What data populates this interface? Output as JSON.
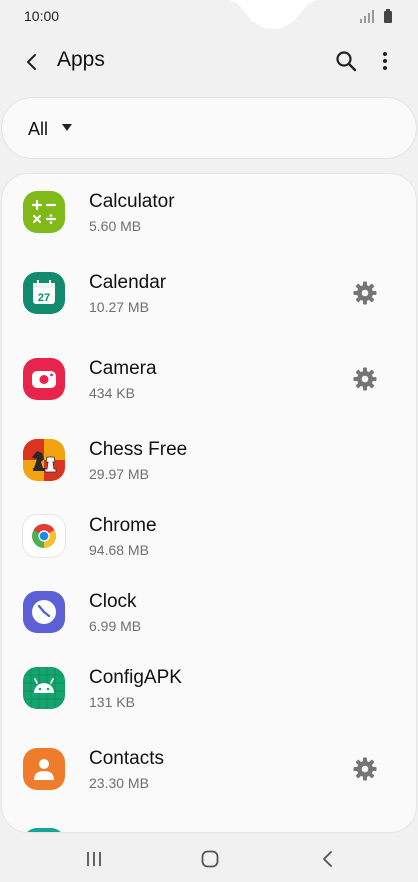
{
  "status": {
    "time": "10:00",
    "icons": [
      "signal-icon",
      "battery-icon"
    ]
  },
  "appbar": {
    "title": "Apps",
    "icons": [
      "back-icon",
      "search-icon",
      "more-vert-icon"
    ]
  },
  "filter": {
    "label": "All"
  },
  "apps": [
    {
      "name": "Calculator",
      "size": "5.60 MB",
      "icon": "calculator-icon",
      "settings": false
    },
    {
      "name": "Calendar",
      "size": "10.27 MB",
      "icon": "calendar-icon",
      "settings": true
    },
    {
      "name": "Camera",
      "size": "434 KB",
      "icon": "camera-icon",
      "settings": true
    },
    {
      "name": "Chess Free",
      "size": "29.97 MB",
      "icon": "chess-icon",
      "settings": false
    },
    {
      "name": "Chrome",
      "size": "94.68 MB",
      "icon": "chrome-icon",
      "settings": false
    },
    {
      "name": "Clock",
      "size": "6.99 MB",
      "icon": "clock-icon",
      "settings": false
    },
    {
      "name": "ConfigAPK",
      "size": "131 KB",
      "icon": "android-icon",
      "settings": false
    },
    {
      "name": "Contacts",
      "size": "23.30 MB",
      "icon": "contacts-icon",
      "settings": true
    }
  ],
  "navbar": {
    "icons": [
      "recents-icon",
      "home-icon",
      "back-nav-icon"
    ]
  },
  "colors": {
    "background": "#f1f1f1",
    "card": "#fafafa",
    "calculator": "#7fba1a",
    "calendar": "#128a6e",
    "camera": "#e8244c",
    "clock": "#5c5fd6",
    "android": "#14a56f",
    "contacts": "#ef7c2b",
    "gear": "#757575"
  }
}
